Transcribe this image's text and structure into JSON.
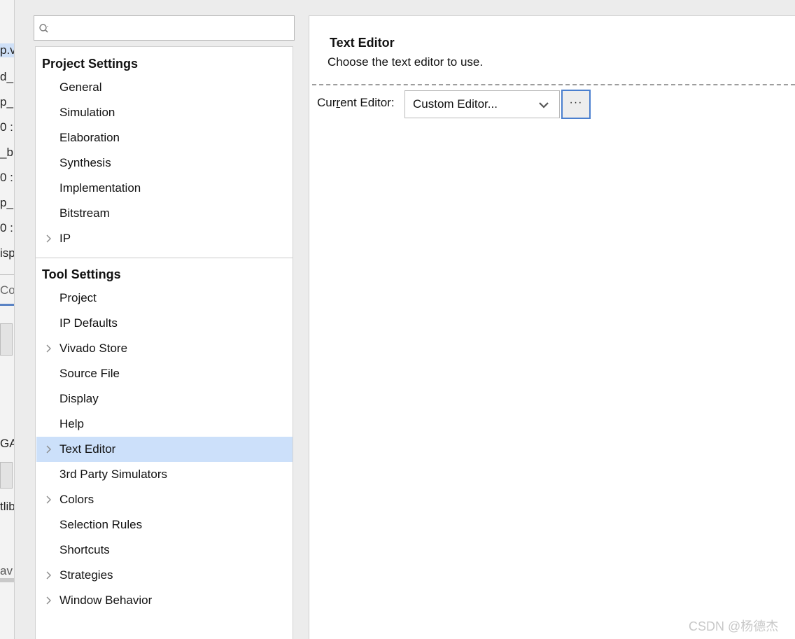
{
  "search": {
    "value": "",
    "placeholder": ""
  },
  "project_settings": {
    "title": "Project Settings",
    "items": [
      {
        "label": "General",
        "expandable": false
      },
      {
        "label": "Simulation",
        "expandable": false
      },
      {
        "label": "Elaboration",
        "expandable": false
      },
      {
        "label": "Synthesis",
        "expandable": false
      },
      {
        "label": "Implementation",
        "expandable": false
      },
      {
        "label": "Bitstream",
        "expandable": false
      },
      {
        "label": "IP",
        "expandable": true
      }
    ]
  },
  "tool_settings": {
    "title": "Tool Settings",
    "items": [
      {
        "label": "Project",
        "expandable": false
      },
      {
        "label": "IP Defaults",
        "expandable": false
      },
      {
        "label": "Vivado Store",
        "expandable": true
      },
      {
        "label": "Source File",
        "expandable": false
      },
      {
        "label": "Display",
        "expandable": false
      },
      {
        "label": "Help",
        "expandable": false
      },
      {
        "label": "Text Editor",
        "expandable": true,
        "selected": true
      },
      {
        "label": "3rd Party Simulators",
        "expandable": false
      },
      {
        "label": "Colors",
        "expandable": true
      },
      {
        "label": "Selection Rules",
        "expandable": false
      },
      {
        "label": "Shortcuts",
        "expandable": false
      },
      {
        "label": "Strategies",
        "expandable": true
      },
      {
        "label": "Window Behavior",
        "expandable": true
      }
    ]
  },
  "content": {
    "title": "Text Editor",
    "description": "Choose the text editor to use.",
    "editor_label_pre": "Cur",
    "editor_label_mnemonic": "r",
    "editor_label_post": "ent Editor:",
    "editor_value": "Custom Editor...",
    "browse_label": "···"
  },
  "background_window": {
    "fragments": [
      "p.v",
      "d_",
      "p_",
      "0 :",
      "_b",
      "0 :",
      "p_b",
      "0 :",
      "isp",
      "Co",
      "GA",
      "tlib",
      "av"
    ]
  },
  "watermark": "CSDN @杨德杰",
  "colors": {
    "selection": "#cce0fa",
    "focus_border": "#4a7fcf",
    "pane_bg": "#ececec"
  }
}
